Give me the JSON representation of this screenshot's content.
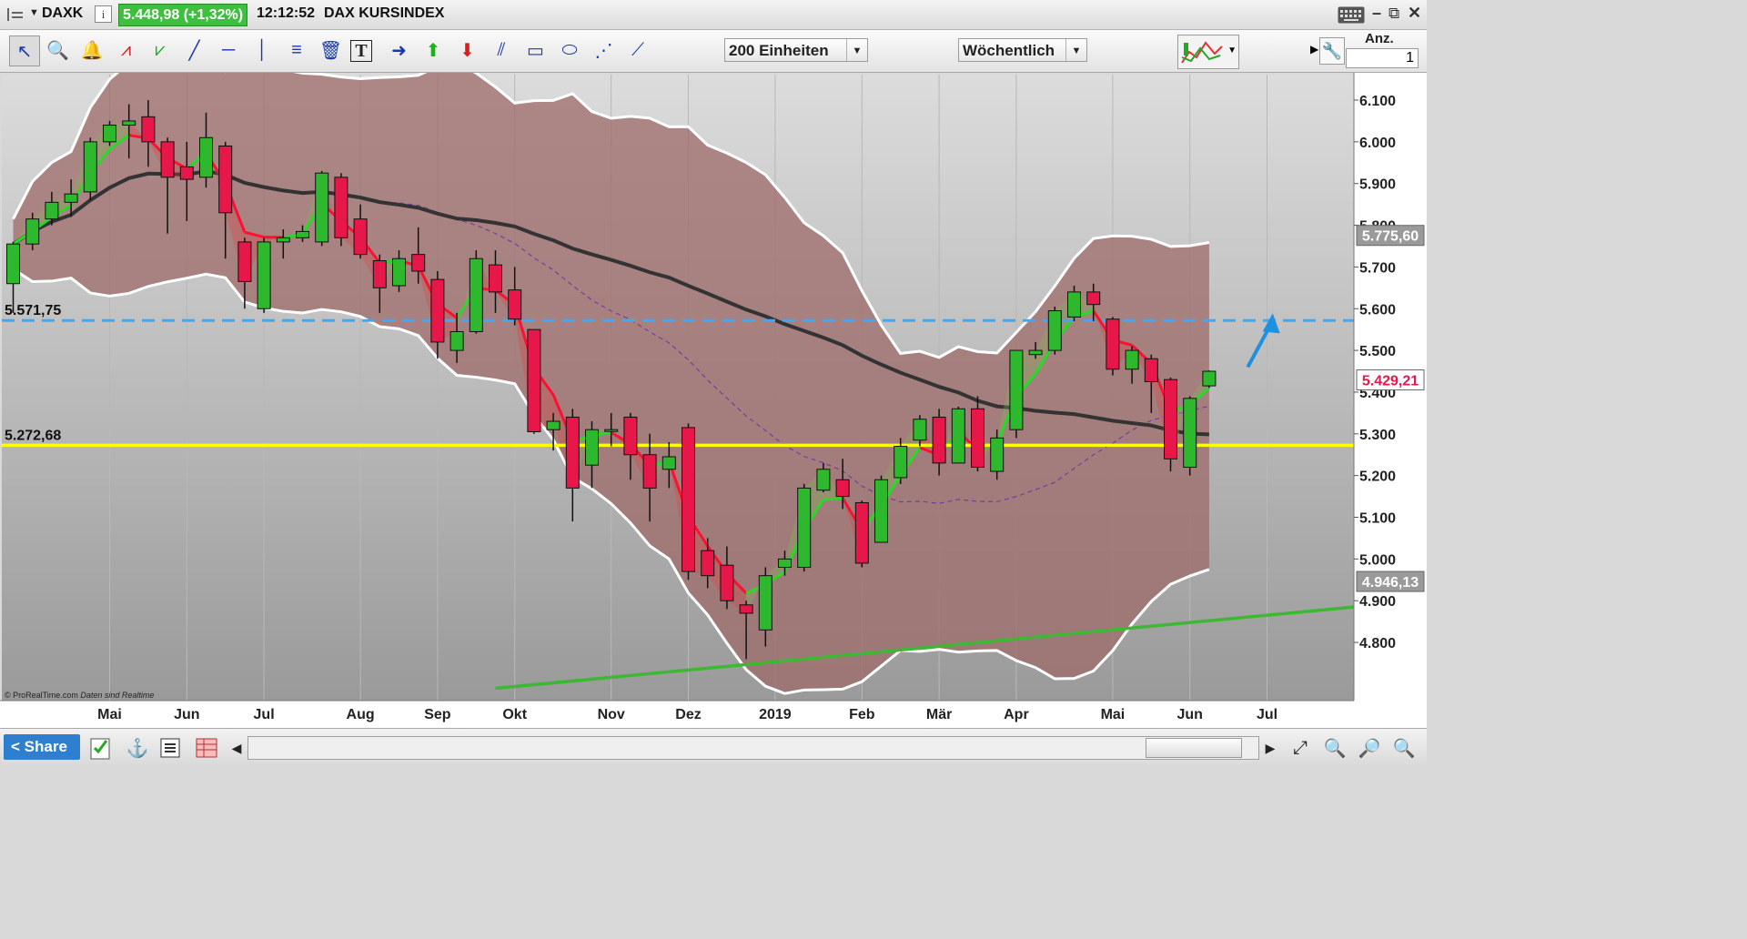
{
  "header": {
    "symbol": "DAXK",
    "info_icon": "info-icon",
    "price": "5.448,98 (+1,32%)",
    "time": "12:12:52",
    "name": "DAX KURSINDEX",
    "count_label": "Anz.",
    "count_value": "1"
  },
  "toolbar": {
    "units_select": "200 Einheiten",
    "period_select": "Wöchentlich",
    "tools": [
      "cursor-icon",
      "zoom-icon",
      "alert-bell-icon",
      "zigzag-icon",
      "trend-lines-icon",
      "line-icon",
      "horizontal-line-icon",
      "vertical-line-icon",
      "fibonacci-icon",
      "delete-icon",
      "text-icon",
      "arrow-right-icon",
      "arrow-up-icon",
      "arrow-down-icon",
      "channel-icon",
      "rectangle-icon",
      "ellipse-icon",
      "fan-icon",
      "segment-icon"
    ],
    "indicator_icon": "indicator-chart-icon",
    "wrench_icon": "wrench-icon"
  },
  "bottom": {
    "share_label": "Share",
    "credit": "© ProRealTime.com",
    "credit_note": "Daten sind Realtime"
  },
  "colors": {
    "up": "#2db82d",
    "down": "#e8174a",
    "band_fill": "#9e6a6a",
    "ma_fast": "#ff1030",
    "ma_fast_up": "#22dd22",
    "ma_slow": "#333333",
    "support": "#ffff00",
    "resistance": "#3fa9f5",
    "trend": "#3cb832"
  },
  "chart_data": {
    "type": "candlestick",
    "title": "DAX KURSINDEX",
    "timeframe": "Wöchentlich",
    "ylim": [
      4700,
      6150
    ],
    "yticks": [
      6100,
      6000,
      5900,
      5800,
      5700,
      5600,
      5500,
      5400,
      5300,
      5200,
      5100,
      5000,
      4900,
      4800
    ],
    "ytick_labels": [
      "6.100",
      "6.000",
      "5.900",
      "5.800",
      "5.700",
      "5.600",
      "5.500",
      "5.400",
      "5.300",
      "5.200",
      "5.100",
      "5.000",
      "4.900",
      "4.800"
    ],
    "months": [
      {
        "label": "Mai",
        "week": 5
      },
      {
        "label": "Jun",
        "week": 9
      },
      {
        "label": "Jul",
        "week": 13
      },
      {
        "label": "Aug",
        "week": 18
      },
      {
        "label": "Sep",
        "week": 22
      },
      {
        "label": "Okt",
        "week": 26
      },
      {
        "label": "Nov",
        "week": 31
      },
      {
        "label": "Dez",
        "week": 35
      },
      {
        "label": "2019",
        "week": 39.5
      },
      {
        "label": "Feb",
        "week": 44
      },
      {
        "label": "Mär",
        "week": 48
      },
      {
        "label": "Apr",
        "week": 52
      },
      {
        "label": "Mai",
        "week": 57
      },
      {
        "label": "Jun",
        "week": 61
      },
      {
        "label": "Jul",
        "week": 65
      }
    ],
    "candles": [
      [
        5660,
        5755,
        5590,
        5760
      ],
      [
        5755,
        5815,
        5740,
        5830
      ],
      [
        5815,
        5855,
        5800,
        5880
      ],
      [
        5855,
        5875,
        5820,
        5910
      ],
      [
        5880,
        6000,
        5860,
        6010
      ],
      [
        6000,
        6040,
        5990,
        6050
      ],
      [
        6040,
        6050,
        5960,
        6090
      ],
      [
        6060,
        6000,
        5940,
        6100
      ],
      [
        6000,
        5915,
        5780,
        6010
      ],
      [
        5940,
        5910,
        5810,
        6000
      ],
      [
        5915,
        6010,
        5890,
        6070
      ],
      [
        5990,
        5830,
        5720,
        6000
      ],
      [
        5760,
        5665,
        5600,
        5770
      ],
      [
        5600,
        5760,
        5590,
        5770
      ],
      [
        5760,
        5770,
        5720,
        5790
      ],
      [
        5770,
        5785,
        5760,
        5800
      ],
      [
        5760,
        5925,
        5750,
        5930
      ],
      [
        5915,
        5770,
        5750,
        5925
      ],
      [
        5815,
        5730,
        5720,
        5850
      ],
      [
        5715,
        5650,
        5590,
        5730
      ],
      [
        5655,
        5720,
        5640,
        5740
      ],
      [
        5730,
        5690,
        5660,
        5795
      ],
      [
        5670,
        5520,
        5480,
        5690
      ],
      [
        5500,
        5545,
        5470,
        5590
      ],
      [
        5545,
        5720,
        5540,
        5740
      ],
      [
        5705,
        5640,
        5590,
        5740
      ],
      [
        5645,
        5575,
        5560,
        5700
      ],
      [
        5550,
        5305,
        5300,
        5550
      ],
      [
        5310,
        5330,
        5260,
        5350
      ],
      [
        5340,
        5170,
        5090,
        5360
      ],
      [
        5225,
        5310,
        5170,
        5330
      ],
      [
        5310,
        5310,
        5270,
        5350
      ],
      [
        5340,
        5250,
        5190,
        5350
      ],
      [
        5250,
        5170,
        5090,
        5300
      ],
      [
        5215,
        5245,
        5170,
        5280
      ],
      [
        5315,
        4970,
        4950,
        5325
      ],
      [
        5020,
        4960,
        4930,
        5050
      ],
      [
        4985,
        4900,
        4880,
        5030
      ],
      [
        4890,
        4870,
        4760,
        4900
      ],
      [
        4830,
        4960,
        4790,
        4980
      ],
      [
        4980,
        5000,
        4960,
        5020
      ],
      [
        4980,
        5170,
        4970,
        5180
      ],
      [
        5165,
        5215,
        5160,
        5230
      ],
      [
        5190,
        5150,
        5120,
        5240
      ],
      [
        5135,
        4990,
        4980,
        5140
      ],
      [
        5040,
        5190,
        5040,
        5200
      ],
      [
        5195,
        5270,
        5180,
        5290
      ],
      [
        5285,
        5335,
        5270,
        5345
      ],
      [
        5340,
        5230,
        5200,
        5360
      ],
      [
        5230,
        5360,
        5230,
        5365
      ],
      [
        5360,
        5220,
        5210,
        5390
      ],
      [
        5210,
        5290,
        5190,
        5310
      ],
      [
        5310,
        5500,
        5290,
        5500
      ],
      [
        5490,
        5500,
        5480,
        5520
      ],
      [
        5500,
        5595,
        5490,
        5605
      ],
      [
        5580,
        5640,
        5570,
        5655
      ],
      [
        5640,
        5610,
        5570,
        5660
      ],
      [
        5575,
        5455,
        5440,
        5580
      ],
      [
        5455,
        5500,
        5420,
        5510
      ],
      [
        5480,
        5425,
        5350,
        5490
      ],
      [
        5430,
        5240,
        5210,
        5435
      ],
      [
        5220,
        5385,
        5200,
        5390
      ],
      [
        5415,
        5450,
        5410,
        5452
      ]
    ],
    "levels": [
      {
        "name": "resistance",
        "value": 5571.75,
        "label": "5.571,75"
      },
      {
        "name": "support",
        "value": 5272.68,
        "label": "5.272,68"
      }
    ],
    "price_tags": [
      {
        "value": 5775.6,
        "label": "5.775,60"
      },
      {
        "value": 5429.21,
        "label": "5.429,21"
      },
      {
        "value": 4946.13,
        "label": "4.946,13"
      }
    ],
    "trendline": {
      "from": [
        25,
        4690
      ],
      "to": [
        73,
        4885
      ]
    },
    "projection_arrow": {
      "from": [
        64,
        5460
      ],
      "to": [
        65.2,
        5580
      ]
    }
  }
}
